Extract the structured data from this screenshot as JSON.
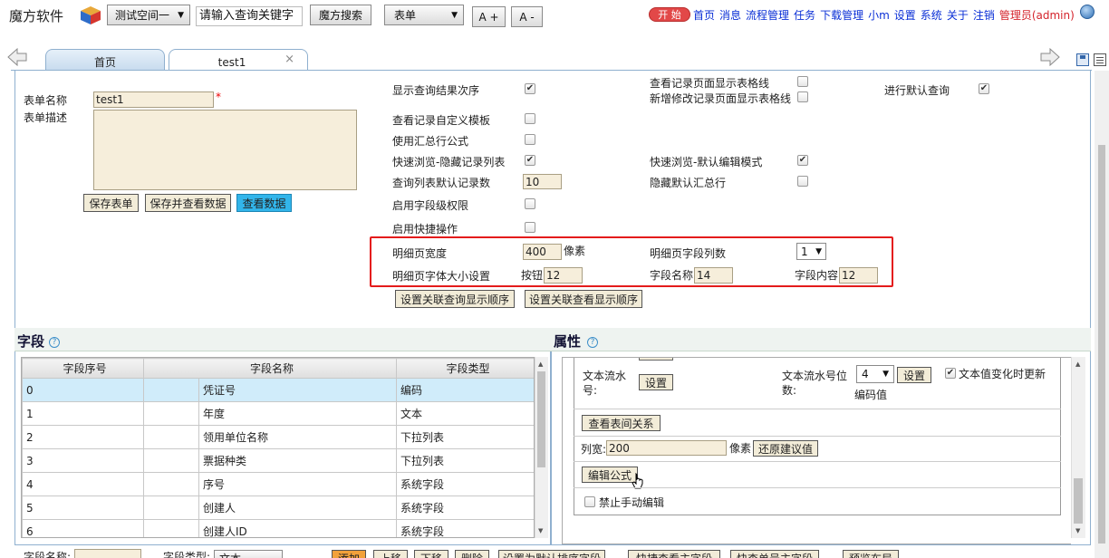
{
  "header": {
    "brand": "魔方软件",
    "workspace": "测试空间一",
    "search_placeholder": "请输入查询关键字",
    "search_button": "魔方搜索",
    "form_select": "表单",
    "font_plus": "A +",
    "font_minus": "A -",
    "start_label": "开 始",
    "nav": [
      "首页",
      "消息",
      "流程管理",
      "任务",
      "下载管理",
      "小m",
      "设置",
      "系统",
      "关于",
      "注销"
    ],
    "user": "管理员(admin)"
  },
  "tabs": {
    "home": "首页",
    "active": "test1",
    "close": "×"
  },
  "form": {
    "name_label": "表单名称",
    "name_value": "test1",
    "required_mark": "*",
    "desc_label": "表单描述",
    "save": "保存表单",
    "save_view": "保存并查看数据",
    "view_data": "查看数据"
  },
  "options": {
    "show_order": "显示查询结果次序",
    "custom_template": "查看记录自定义模板",
    "summary_formula": "使用汇总行公式",
    "quick_hide": "快速浏览-隐藏记录列表",
    "default_count_label": "查询列表默认记录数",
    "default_count": "10",
    "field_perm": "启用字段级权限",
    "quick_ops": "启用快捷操作",
    "grid_view": "查看记录页面显示表格线",
    "grid_edit": "新增修改记录页面显示表格线",
    "default_query": "进行默认查询",
    "quick_edit": "快速浏览-默认编辑模式",
    "hide_summary": "隐藏默认汇总行",
    "detail_width_label": "明细页宽度",
    "detail_width": "400",
    "px_unit": "像素",
    "detail_cols_label": "明细页字段列数",
    "detail_cols": "1",
    "font_size_label": "明细页字体大小设置",
    "btn_label": "按钮",
    "btn_size": "12",
    "fname_label": "字段名称",
    "fname_size": "14",
    "fcontent_label": "字段内容",
    "fcontent_size": "12",
    "assoc_query": "设置关联查询显示顺序",
    "assoc_view": "设置关联查看显示顺序"
  },
  "fields": {
    "title": "字段",
    "help": "?",
    "headers": [
      "字段序号",
      "字段名称",
      "字段类型"
    ],
    "rows": [
      [
        "0",
        "凭证号",
        "编码"
      ],
      [
        "1",
        "年度",
        "文本"
      ],
      [
        "2",
        "领用单位名称",
        "下拉列表"
      ],
      [
        "3",
        "票据种类",
        "下拉列表"
      ],
      [
        "4",
        "序号",
        "系统字段"
      ],
      [
        "5",
        "创建人",
        "系统字段"
      ],
      [
        "6",
        "创建人ID",
        "系统字段"
      ]
    ]
  },
  "props": {
    "title": "属性",
    "help": "?",
    "serial_label": "文本流水号:",
    "set": "设置",
    "serial_digits_label": "文本流水号位数:",
    "serial_digits": "4",
    "encode_value": "编码值",
    "update_on_change": "文本值变化时更新",
    "view_relation": "查看表间关系",
    "col_width_label": "列宽:",
    "col_width": "200",
    "px": "像素",
    "restore": "还原建议值",
    "edit_formula": "编辑公式",
    "no_manual": "禁止手动编辑"
  },
  "bottom": {
    "field_name_label": "字段名称:",
    "field_type_label": "字段类型:",
    "field_type": "文本",
    "add": "添加",
    "up": "上移",
    "down": "下移",
    "delete": "删除",
    "b1": "设置为默认排序字段",
    "b2": "快捷查看主字段",
    "b3": "快查单号主字段",
    "b4": "预览布局"
  }
}
